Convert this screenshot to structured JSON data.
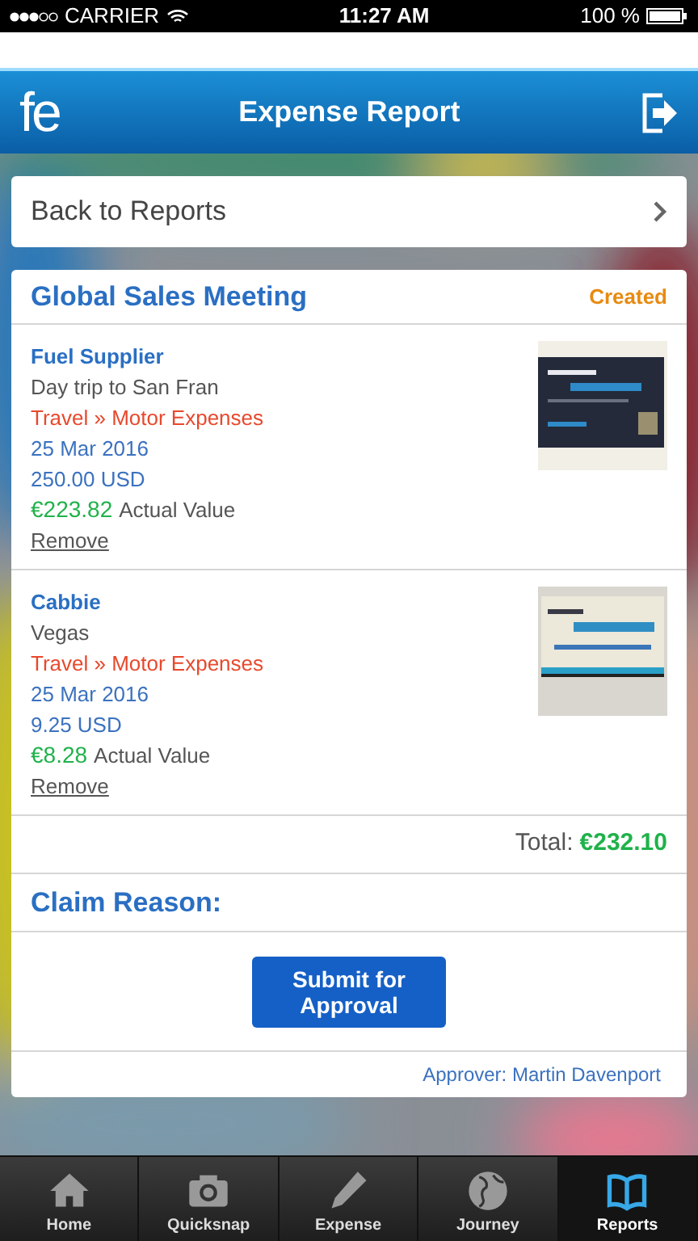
{
  "status_bar": {
    "carrier": "CARRIER",
    "time": "11:27 AM",
    "battery": "100 %"
  },
  "header": {
    "logo": "fe",
    "title": "Expense Report"
  },
  "back_link": "Back to Reports",
  "report": {
    "title": "Global Sales Meeting",
    "status": "Created",
    "expenses": [
      {
        "supplier": "Fuel Supplier",
        "description": "Day trip to San Fran",
        "category": "Travel » Motor Expenses",
        "date": "25 Mar 2016",
        "amount": "250.00 USD",
        "actual_amount": "€223.82",
        "actual_label": "Actual Value",
        "remove": "Remove"
      },
      {
        "supplier": "Cabbie",
        "description": "Vegas",
        "category": "Travel » Motor Expenses",
        "date": "25 Mar 2016",
        "amount": "9.25 USD",
        "actual_amount": "€8.28",
        "actual_label": "Actual Value",
        "remove": "Remove"
      }
    ],
    "total_label": "Total:",
    "total": "€232.10",
    "claim_reason_label": "Claim Reason:",
    "submit": "Submit for Approval",
    "approver": "Approver: Martin Davenport"
  },
  "tab_bar": [
    {
      "label": "Home",
      "kind": "home",
      "selected": false
    },
    {
      "label": "Quicksnap",
      "kind": "camera",
      "selected": false
    },
    {
      "label": "Expense",
      "kind": "pencil",
      "selected": false
    },
    {
      "label": "Journey",
      "kind": "globe",
      "selected": false
    },
    {
      "label": "Reports",
      "kind": "book",
      "selected": true
    }
  ]
}
